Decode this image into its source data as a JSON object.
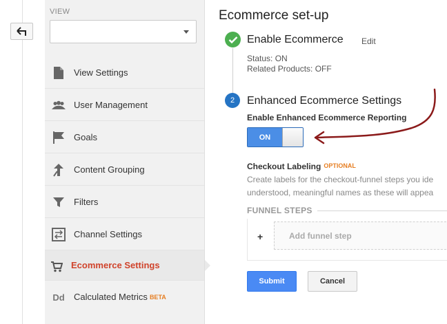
{
  "sidebar": {
    "view_label": "VIEW",
    "view_select_value": "",
    "items": [
      {
        "label": "View Settings",
        "icon": "document-icon"
      },
      {
        "label": "User Management",
        "icon": "users-icon"
      },
      {
        "label": "Goals",
        "icon": "flag-icon"
      },
      {
        "label": "Content Grouping",
        "icon": "content-grouping-icon"
      },
      {
        "label": "Filters",
        "icon": "filter-icon"
      },
      {
        "label": "Channel Settings",
        "icon": "channel-settings-icon"
      },
      {
        "label": "Ecommerce Settings",
        "icon": "cart-icon",
        "active": true
      },
      {
        "label": "Calculated Metrics",
        "icon": "dd-icon",
        "icon_text": "Dd",
        "badge": "BETA"
      }
    ]
  },
  "main": {
    "title": "Ecommerce set-up",
    "step1": {
      "title": "Enable Ecommerce",
      "edit": "Edit",
      "status": "Status: ON",
      "related": "Related Products: OFF"
    },
    "step2": {
      "number": "2",
      "title": "Enhanced Ecommerce Settings",
      "reporting_label": "Enable Enhanced Ecommerce Reporting",
      "toggle_value": "ON"
    },
    "checkout": {
      "label": "Checkout Labeling",
      "optional": "OPTIONAL",
      "description": "Create labels for the checkout-funnel steps you ide understood, meaningful names as these will appea",
      "desc_line1": "Create labels for the checkout-funnel steps you ide",
      "desc_line2": "understood, meaningful names as these will appea"
    },
    "funnel": {
      "header": "FUNNEL STEPS",
      "plus": "+",
      "add_step": "Add funnel step"
    },
    "buttons": {
      "submit": "Submit",
      "cancel": "Cancel"
    }
  },
  "colors": {
    "accent_blue": "#4a8af4",
    "active_nav": "#d0432b",
    "success_green": "#4caf50",
    "annotation": "#8b1a1a",
    "badge_orange": "#e67e22"
  }
}
